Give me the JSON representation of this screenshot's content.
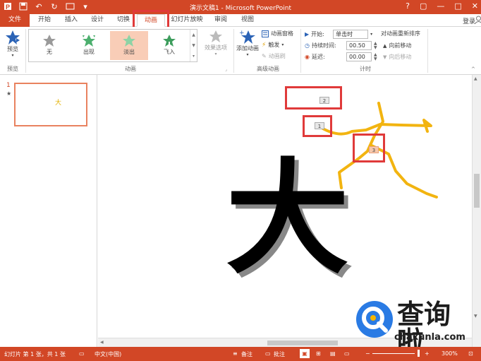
{
  "window": {
    "title": "演示文稿1 - Microsoft PowerPoint",
    "controls": [
      "?",
      "▢",
      "—",
      "□",
      "✕"
    ]
  },
  "tabs": {
    "file": "文件",
    "items": [
      "开始",
      "插入",
      "设计",
      "切换",
      "动画",
      "幻灯片放映",
      "审阅",
      "视图"
    ],
    "active": "动画",
    "login": "登录"
  },
  "ribbon": {
    "preview": {
      "button": "预览",
      "group": "预览"
    },
    "animation": {
      "gallery": [
        "无",
        "出现",
        "淡出",
        "飞入"
      ],
      "selected": "淡出",
      "effect_options": "效果选项",
      "group": "动画"
    },
    "advanced": {
      "add_animation": "添加动画",
      "pane": "动画窗格",
      "trigger": "触发",
      "painter": "动画刷",
      "group": "高级动画"
    },
    "timing": {
      "start_label": "开始:",
      "start_value": "单击时",
      "duration_label": "持续时间:",
      "duration_value": "00.50",
      "delay_label": "延迟:",
      "delay_value": "00.00",
      "reorder_title": "对动画重新排序",
      "move_earlier": "向前移动",
      "move_later": "向后移动",
      "group": "计时"
    }
  },
  "slides_pane": {
    "slide_number": "1",
    "thumb_char": "大"
  },
  "canvas": {
    "big_char": "大",
    "badges": [
      "2",
      "1",
      "3"
    ]
  },
  "watermark": {
    "text": "查询啦",
    "url": "chaxunla.com"
  },
  "statusbar": {
    "slide_info": "幻灯片 第 1 张，共 1 张",
    "language": "中文(中国)",
    "notes": "备注",
    "comments": "批注",
    "zoom": "300%"
  },
  "colors": {
    "accent": "#d24726",
    "highlight_box": "#e03a3a",
    "motion_path": "#f2b410",
    "selected_gallery": "#f9cdb7"
  }
}
